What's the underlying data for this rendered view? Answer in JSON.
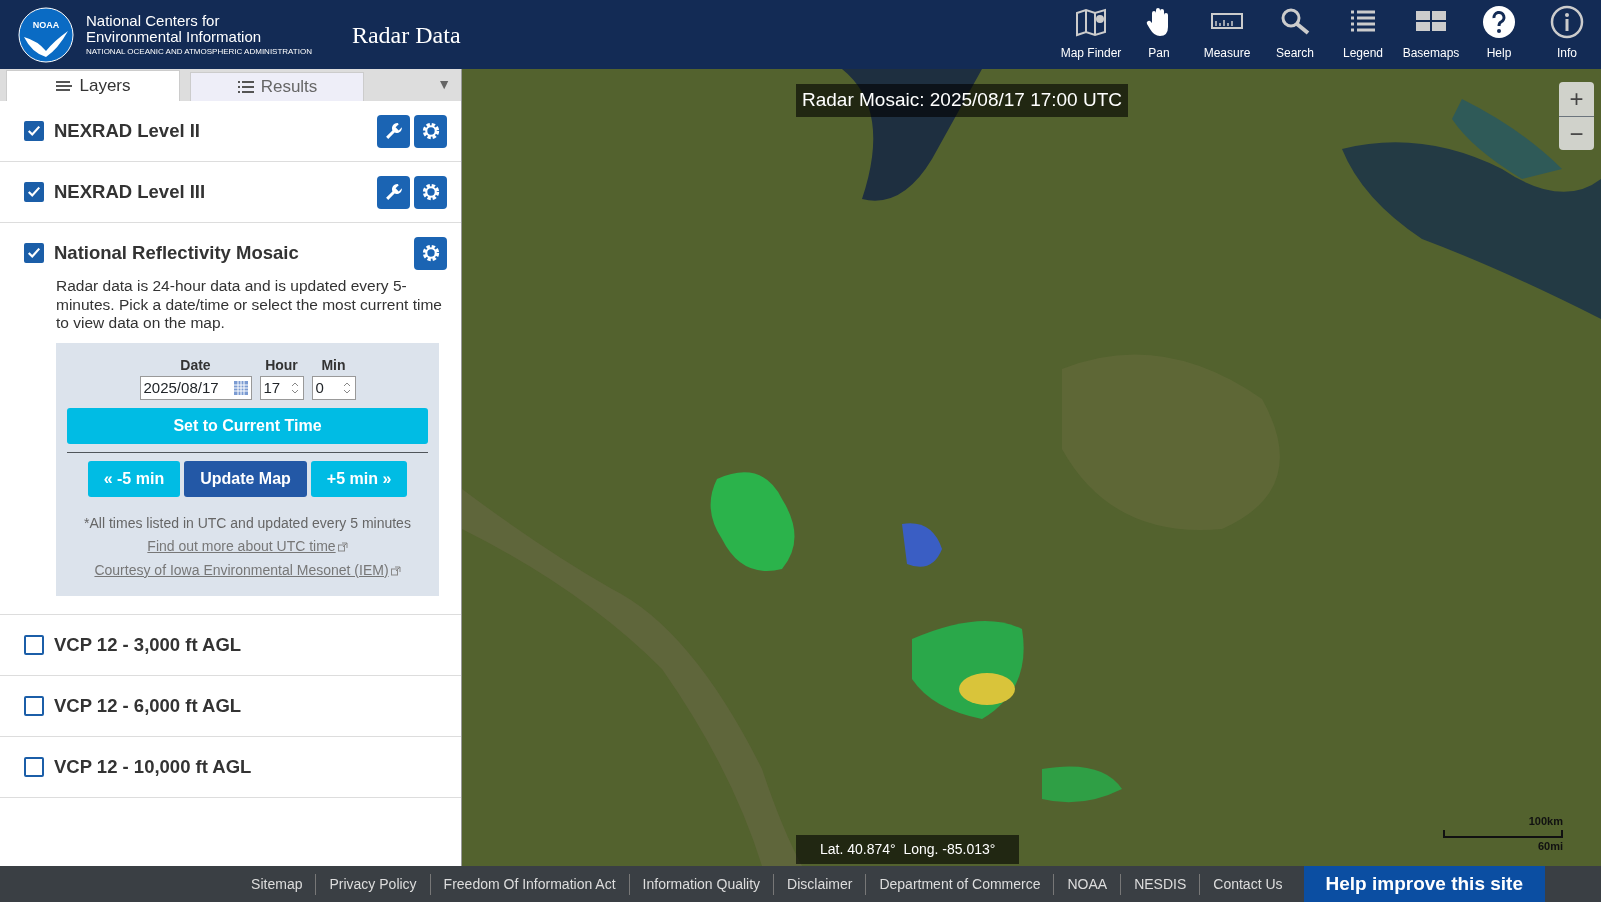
{
  "header": {
    "org_name": "National Centers for Environmental Information",
    "org_subtitle": "NATIONAL OCEANIC AND ATMOSPHERIC ADMINISTRATION",
    "logo_text": "NOAA",
    "app_title": "Radar Data",
    "tools": [
      {
        "label": "Map Finder"
      },
      {
        "label": "Pan"
      },
      {
        "label": "Measure"
      },
      {
        "label": "Search"
      },
      {
        "label": "Legend"
      },
      {
        "label": "Basemaps"
      },
      {
        "label": "Help"
      },
      {
        "label": "Info"
      }
    ]
  },
  "tabs": [
    {
      "label": "Layers",
      "selected": true
    },
    {
      "label": "Results",
      "selected": false
    }
  ],
  "tab_menu": "▼",
  "layers": [
    {
      "name": "NEXRAD Level II",
      "checked": true,
      "tools": [
        {
          "kind": "wrench"
        },
        {
          "kind": "gear"
        }
      ]
    },
    {
      "name": "NEXRAD Level III",
      "checked": true,
      "tools": [
        {
          "kind": "wrench"
        },
        {
          "kind": "gear"
        }
      ]
    },
    {
      "name": "National Reflectivity Mosaic",
      "checked": true,
      "tools": [
        {
          "kind": "gear"
        }
      ],
      "description": "Radar data is 24-hour data and is updated every 5-minutes. Pick a date/time or select the most current time to view data on the map.",
      "form": {
        "date_label": "Date",
        "date": "2025/08/17",
        "hour_label": "Hour",
        "hour": "17",
        "min_label": "Min",
        "min": "0",
        "current_button": "Set to Current Time",
        "back_button": "« -5 min",
        "update_button": "Update Map",
        "forward_button": "+5 min »",
        "note": "*All times listed in UTC and updated every 5 minutes",
        "links": [
          "Find out more about UTC time",
          "Courtesy of Iowa Environmental Mesonet (IEM)"
        ]
      }
    },
    {
      "name": "VCP 12 - 3,000 ft AGL",
      "checked": false
    },
    {
      "name": "VCP 12 - 6,000 ft AGL",
      "checked": false
    },
    {
      "name": "VCP 12 - 10,000 ft AGL",
      "checked": false
    }
  ],
  "map": {
    "title": "Radar Mosaic: 2025/08/17 17:00 UTC",
    "coordinates": "Lat. 40.874°  Long. -85.013°",
    "zoom_in": "+",
    "zoom_out": "−",
    "scale_km": "100km",
    "scale_mi": "60mi"
  },
  "footer": {
    "links": [
      "Sitemap",
      "Privacy Policy",
      "Freedom Of Information Act",
      "Information Quality",
      "Disclaimer",
      "Department of Commerce",
      "NOAA",
      "NESDIS",
      "Contact Us"
    ],
    "feedback_button": "Help improve this site"
  }
}
